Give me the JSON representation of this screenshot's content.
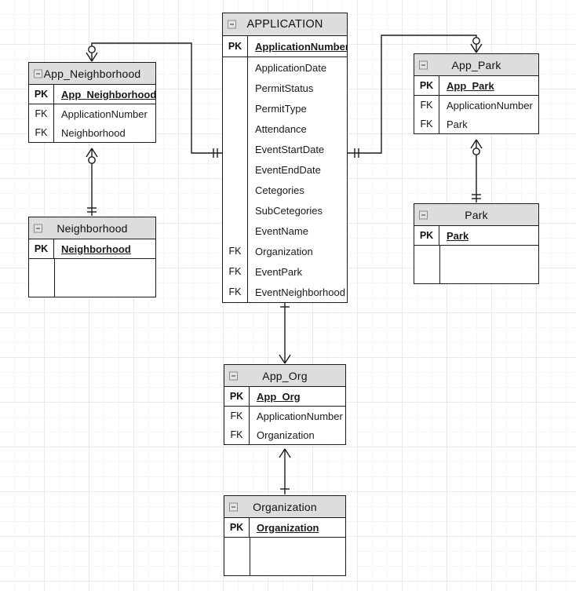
{
  "diagram": {
    "type": "entity-relationship-diagram",
    "background": "#ffffff",
    "grid_minor_color": "#f6f6f6",
    "grid_major_color": "#e9e9e9",
    "header_fill": "#dddddd",
    "line_color": "#1b1b1b"
  },
  "entities": [
    {
      "id": "application",
      "title": "APPLICATION",
      "groups": [
        [
          {
            "key": "PK",
            "name": "ApplicationNumber",
            "pk": true
          }
        ],
        [
          {
            "key": "",
            "name": "ApplicationDate",
            "pk": false
          },
          {
            "key": "",
            "name": "PermitStatus",
            "pk": false
          },
          {
            "key": "",
            "name": "PermitType",
            "pk": false
          },
          {
            "key": "",
            "name": "Attendance",
            "pk": false
          },
          {
            "key": "",
            "name": "EventStartDate",
            "pk": false
          },
          {
            "key": "",
            "name": "EventEndDate",
            "pk": false
          },
          {
            "key": "",
            "name": "Cetegories",
            "pk": false
          },
          {
            "key": "",
            "name": "SubCetegories",
            "pk": false
          },
          {
            "key": "",
            "name": "EventName",
            "pk": false
          },
          {
            "key": "FK",
            "name": "Organization",
            "pk": false
          },
          {
            "key": "FK",
            "name": "EventPark",
            "pk": false
          },
          {
            "key": "FK",
            "name": "EventNeighborhood",
            "pk": false
          }
        ]
      ]
    },
    {
      "id": "app-neighborhood",
      "title": "App_Neighborhood",
      "groups": [
        [
          {
            "key": "PK",
            "name": "App_Neighborhood",
            "pk": true
          }
        ],
        [
          {
            "key": "FK",
            "name": "ApplicationNumber",
            "pk": false
          },
          {
            "key": "FK",
            "name": "Neighborhood",
            "pk": false
          }
        ]
      ]
    },
    {
      "id": "neighborhood",
      "title": "Neighborhood",
      "groups": [
        [
          {
            "key": "PK",
            "name": "Neighborhood",
            "pk": true
          }
        ],
        []
      ]
    },
    {
      "id": "app-park",
      "title": "App_Park",
      "groups": [
        [
          {
            "key": "PK",
            "name": "App_Park",
            "pk": true
          }
        ],
        [
          {
            "key": "FK",
            "name": "ApplicationNumber",
            "pk": false
          },
          {
            "key": "FK",
            "name": "Park",
            "pk": false
          }
        ]
      ]
    },
    {
      "id": "park",
      "title": "Park",
      "groups": [
        [
          {
            "key": "PK",
            "name": "Park",
            "pk": true
          }
        ],
        []
      ]
    },
    {
      "id": "app-org",
      "title": "App_Org",
      "groups": [
        [
          {
            "key": "PK",
            "name": "App_Org",
            "pk": true
          }
        ],
        [
          {
            "key": "FK",
            "name": "ApplicationNumber",
            "pk": false
          },
          {
            "key": "FK",
            "name": "Organization",
            "pk": false
          }
        ]
      ]
    },
    {
      "id": "organization",
      "title": "Organization",
      "groups": [
        [
          {
            "key": "PK",
            "name": "Organization",
            "pk": true
          }
        ],
        []
      ]
    }
  ],
  "relationships": [
    {
      "from": "application",
      "to": "app-neighborhood",
      "from_cardinality": "one-and-only-one",
      "to_cardinality": "zero-or-many"
    },
    {
      "from": "neighborhood",
      "to": "app-neighborhood",
      "from_cardinality": "one-and-only-one",
      "to_cardinality": "zero-or-many"
    },
    {
      "from": "application",
      "to": "app-park",
      "from_cardinality": "one-and-only-one",
      "to_cardinality": "zero-or-many"
    },
    {
      "from": "park",
      "to": "app-park",
      "from_cardinality": "one-and-only-one",
      "to_cardinality": "zero-or-many"
    },
    {
      "from": "application",
      "to": "app-org",
      "from_cardinality": "one-and-only-one",
      "to_cardinality": "many"
    },
    {
      "from": "organization",
      "to": "app-org",
      "from_cardinality": "one-and-only-one",
      "to_cardinality": "many"
    }
  ],
  "icons": {
    "collapse": "minus-box-icon"
  }
}
